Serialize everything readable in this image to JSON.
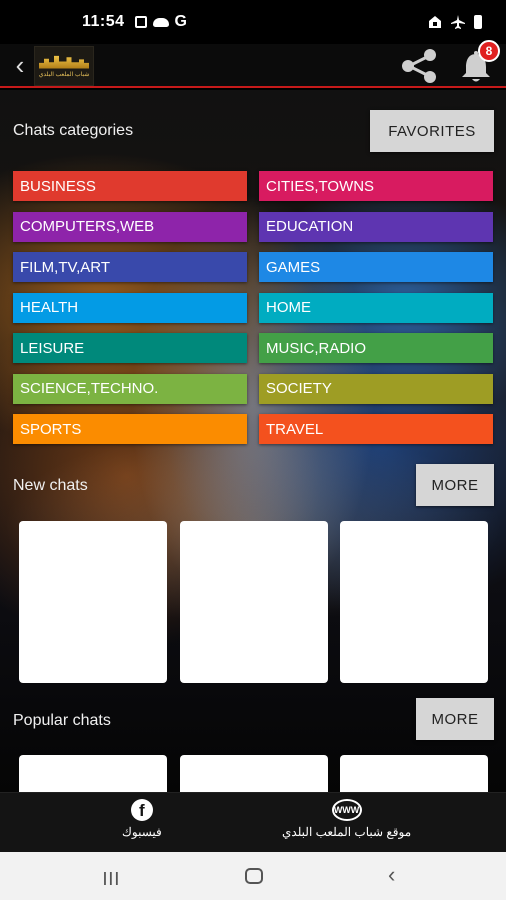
{
  "status_bar": {
    "time": "11:54",
    "g_label": "G"
  },
  "app_bar": {
    "logo_text": "شباب الملعب البلدي",
    "notification_count": "8"
  },
  "categories_section": {
    "title": "Chats categories",
    "favorites_label": "FAVORITES",
    "items": [
      {
        "label": "BUSINESS",
        "color": "#e03a2e"
      },
      {
        "label": "CITIES,TOWNS",
        "color": "#d81b60"
      },
      {
        "label": "COMPUTERS,WEB",
        "color": "#8e24aa"
      },
      {
        "label": "EDUCATION",
        "color": "#5e35b1"
      },
      {
        "label": "FILM,TV,ART",
        "color": "#3949ab"
      },
      {
        "label": "GAMES",
        "color": "#1e88e5"
      },
      {
        "label": "HEALTH",
        "color": "#039be5"
      },
      {
        "label": "HOME",
        "color": "#00acc1"
      },
      {
        "label": "LEISURE",
        "color": "#00897b"
      },
      {
        "label": "MUSIC,RADIO",
        "color": "#43a047"
      },
      {
        "label": "SCIENCE,TECHNO.",
        "color": "#7cb342"
      },
      {
        "label": "SOCIETY",
        "color": "#9e9d24"
      },
      {
        "label": "SPORTS",
        "color": "#fb8c00"
      },
      {
        "label": "TRAVEL",
        "color": "#f4511e"
      }
    ]
  },
  "new_chats": {
    "title": "New chats",
    "more_label": "MORE"
  },
  "popular_chats": {
    "title": "Popular chats",
    "more_label": "MORE"
  },
  "bottom_nav": {
    "facebook_label": "فيسبوك",
    "website_label": "موقع شباب الملعب البلدي",
    "www_icon_text": "WWW"
  }
}
